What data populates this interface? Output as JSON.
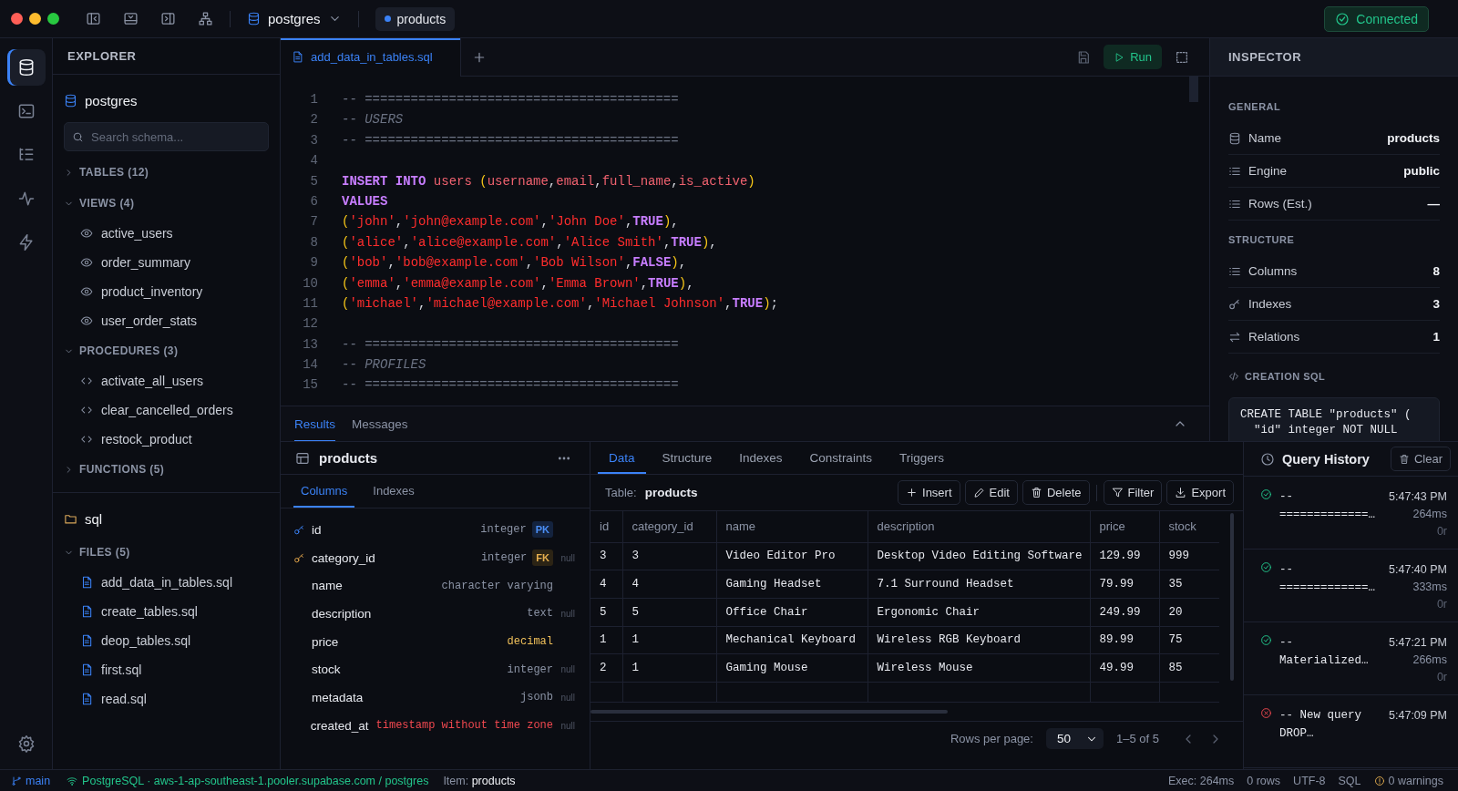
{
  "window_controls": [
    {
      "kind": "close"
    },
    {
      "kind": "minimize"
    },
    {
      "kind": "maximize"
    }
  ],
  "toolbar": {
    "connection_selector": {
      "label": "postgres"
    },
    "open_tab": {
      "label": "products"
    },
    "status": {
      "label": "Connected"
    }
  },
  "activity_bar": {
    "items": [
      {
        "selected": true
      },
      {
        "selected": false
      },
      {
        "selected": false
      },
      {
        "selected": false
      },
      {
        "selected": false
      }
    ]
  },
  "explorer": {
    "title": "EXPLORER",
    "connection": "postgres",
    "search": {
      "placeholder": "Search schema..."
    },
    "sections": [
      {
        "label": "TABLES (12)",
        "expanded": false
      },
      {
        "label": "VIEWS (4)",
        "kind": "view",
        "expanded": true,
        "items": [
          "active_users",
          "order_summary",
          "product_inventory",
          "user_order_stats"
        ]
      },
      {
        "label": "PROCEDURES (3)",
        "kind": "procedure",
        "expanded": true,
        "items": [
          "activate_all_users",
          "clear_cancelled_orders",
          "restock_product"
        ]
      },
      {
        "label": "FUNCTIONS (5)",
        "expanded": false
      }
    ],
    "folder": "sql",
    "file_sections": [
      {
        "label": "FILES (5)",
        "kind": "file",
        "expanded": true,
        "items": [
          "add_data_in_tables.sql",
          "create_tables.sql",
          "deop_tables.sql",
          "first.sql",
          "read.sql"
        ]
      }
    ]
  },
  "editor": {
    "tabs": [
      {
        "label": "add_data_in_tables.sql",
        "selected": true
      }
    ],
    "run_button": "Run",
    "lines": [
      {
        "number": "1",
        "tokens": [
          {
            "kind": "comment",
            "text": "-- ========================================="
          }
        ]
      },
      {
        "number": "2",
        "tokens": [
          {
            "kind": "comment",
            "text": "-- USERS"
          }
        ]
      },
      {
        "number": "3",
        "tokens": [
          {
            "kind": "comment",
            "text": "-- ========================================="
          }
        ]
      },
      {
        "number": "4"
      },
      {
        "number": "5",
        "tokens": [
          {
            "kind": "keyword",
            "text": "INSERT INTO"
          },
          {
            "kind": "ident",
            "text": " users "
          },
          {
            "kind": "paren",
            "text": "("
          },
          {
            "kind": "ident",
            "text": "username"
          },
          {
            "kind": "punct",
            "text": ","
          },
          {
            "kind": "ident",
            "text": "email"
          },
          {
            "kind": "punct",
            "text": ","
          },
          {
            "kind": "ident",
            "text": "full_name"
          },
          {
            "kind": "punct",
            "text": ","
          },
          {
            "kind": "ident",
            "text": "is_active"
          },
          {
            "kind": "paren",
            "text": ")"
          }
        ]
      },
      {
        "number": "6",
        "tokens": [
          {
            "kind": "keyword",
            "text": "VALUES"
          }
        ]
      },
      {
        "number": "7",
        "tokens": [
          {
            "kind": "paren",
            "text": "("
          },
          {
            "kind": "string",
            "text": "'john'"
          },
          {
            "kind": "punct",
            "text": ","
          },
          {
            "kind": "string",
            "text": "'john@example.com'"
          },
          {
            "kind": "punct",
            "text": ","
          },
          {
            "kind": "string",
            "text": "'John Doe'"
          },
          {
            "kind": "punct",
            "text": ","
          },
          {
            "kind": "keyword",
            "text": "TRUE"
          },
          {
            "kind": "paren",
            "text": ")"
          },
          {
            "kind": "punct",
            "text": ","
          }
        ]
      },
      {
        "number": "8",
        "tokens": [
          {
            "kind": "paren",
            "text": "("
          },
          {
            "kind": "string",
            "text": "'alice'"
          },
          {
            "kind": "punct",
            "text": ","
          },
          {
            "kind": "string",
            "text": "'alice@example.com'"
          },
          {
            "kind": "punct",
            "text": ","
          },
          {
            "kind": "string",
            "text": "'Alice Smith'"
          },
          {
            "kind": "punct",
            "text": ","
          },
          {
            "kind": "keyword",
            "text": "TRUE"
          },
          {
            "kind": "paren",
            "text": ")"
          },
          {
            "kind": "punct",
            "text": ","
          }
        ]
      },
      {
        "number": "9",
        "tokens": [
          {
            "kind": "paren",
            "text": "("
          },
          {
            "kind": "string",
            "text": "'bob'"
          },
          {
            "kind": "punct",
            "text": ","
          },
          {
            "kind": "string",
            "text": "'bob@example.com'"
          },
          {
            "kind": "punct",
            "text": ","
          },
          {
            "kind": "string",
            "text": "'Bob Wilson'"
          },
          {
            "kind": "punct",
            "text": ","
          },
          {
            "kind": "keyword",
            "text": "FALSE"
          },
          {
            "kind": "paren",
            "text": ")"
          },
          {
            "kind": "punct",
            "text": ","
          }
        ]
      },
      {
        "number": "10",
        "tokens": [
          {
            "kind": "paren",
            "text": "("
          },
          {
            "kind": "string",
            "text": "'emma'"
          },
          {
            "kind": "punct",
            "text": ","
          },
          {
            "kind": "string",
            "text": "'emma@example.com'"
          },
          {
            "kind": "punct",
            "text": ","
          },
          {
            "kind": "string",
            "text": "'Emma Brown'"
          },
          {
            "kind": "punct",
            "text": ","
          },
          {
            "kind": "keyword",
            "text": "TRUE"
          },
          {
            "kind": "paren",
            "text": ")"
          },
          {
            "kind": "punct",
            "text": ","
          }
        ]
      },
      {
        "number": "11",
        "tokens": [
          {
            "kind": "paren",
            "text": "("
          },
          {
            "kind": "string",
            "text": "'michael'"
          },
          {
            "kind": "punct",
            "text": ","
          },
          {
            "kind": "string",
            "text": "'michael@example.com'"
          },
          {
            "kind": "punct",
            "text": ","
          },
          {
            "kind": "string",
            "text": "'Michael Johnson'"
          },
          {
            "kind": "punct",
            "text": ","
          },
          {
            "kind": "keyword",
            "text": "TRUE"
          },
          {
            "kind": "paren",
            "text": ")"
          },
          {
            "kind": "punct",
            "text": ";"
          }
        ]
      },
      {
        "number": "12"
      },
      {
        "number": "13",
        "tokens": [
          {
            "kind": "comment",
            "text": "-- ========================================="
          }
        ]
      },
      {
        "number": "14",
        "tokens": [
          {
            "kind": "comment",
            "text": "-- PROFILES"
          }
        ]
      },
      {
        "number": "15",
        "tokens": [
          {
            "kind": "comment",
            "text": "-- ========================================="
          }
        ]
      }
    ]
  },
  "inspector": {
    "title": "INSPECTOR",
    "sections": [
      {
        "label": "GENERAL",
        "rows": [
          {
            "kind": "table",
            "label": "Name",
            "value": "products"
          },
          {
            "kind": "list",
            "label": "Engine",
            "value": "public"
          },
          {
            "kind": "list",
            "label": "Rows (Est.)",
            "value": "—"
          }
        ]
      },
      {
        "label": "STRUCTURE",
        "rows": [
          {
            "kind": "list",
            "label": "Columns",
            "value": "8"
          },
          {
            "kind": "key",
            "label": "Indexes",
            "value": "3"
          },
          {
            "kind": "relation",
            "label": "Relations",
            "value": "1"
          }
        ]
      }
    ],
    "creation_sql": {
      "label": "CREATION SQL",
      "lines": [
        "CREATE TABLE \"products\" (",
        "  \"id\" integer NOT NULL"
      ]
    }
  },
  "results_tabs": [
    {
      "label": "Results",
      "selected": true
    },
    {
      "label": "Messages",
      "selected": false
    }
  ],
  "schema_panel": {
    "title": "products",
    "tabs": [
      {
        "label": "Columns",
        "selected": true
      },
      {
        "label": "Indexes",
        "selected": false
      }
    ],
    "columns": [
      {
        "name": "id",
        "type": "integer",
        "color": "#8b93a5",
        "key": {
          "kind": "primary",
          "label": "PK"
        }
      },
      {
        "name": "category_id",
        "type": "integer",
        "color": "#8b93a5",
        "key": {
          "kind": "foreign",
          "label": "FK"
        },
        "note": "null"
      },
      {
        "name": "name",
        "type": "character varying",
        "color": "#8b93a5"
      },
      {
        "name": "description",
        "type": "text",
        "color": "#8b93a5",
        "note": "null"
      },
      {
        "name": "price",
        "type": "decimal",
        "color": "#f0c05a"
      },
      {
        "name": "stock",
        "type": "integer",
        "color": "#8b93a5",
        "note": "null"
      },
      {
        "name": "metadata",
        "type": "jsonb",
        "color": "#8b93a5",
        "note": "null"
      },
      {
        "name": "created_at",
        "type": "timestamp without time zone",
        "color": "#f0484f",
        "note": "null"
      }
    ]
  },
  "data_panel": {
    "tabs": [
      {
        "label": "Data",
        "selected": true
      },
      {
        "label": "Structure",
        "selected": false
      },
      {
        "label": "Indexes",
        "selected": false
      },
      {
        "label": "Constraints",
        "selected": false
      },
      {
        "label": "Triggers",
        "selected": false
      }
    ],
    "table_label": "Table:",
    "table_name": "products",
    "actions": [
      {
        "kind": "insert",
        "label": "Insert"
      },
      {
        "kind": "edit",
        "label": "Edit"
      },
      {
        "kind": "delete",
        "label": "Delete"
      },
      {
        "kind": "filter",
        "label": "Filter"
      },
      {
        "kind": "export",
        "label": "Export"
      }
    ],
    "table": {
      "columns": [
        "id",
        "category_id",
        "name",
        "description",
        "price",
        "stock"
      ],
      "rows": [
        [
          "3",
          "3",
          "Video Editor Pro",
          "Desktop Video Editing Software",
          "129.99",
          "999"
        ],
        [
          "4",
          "4",
          "Gaming Headset",
          "7.1 Surround Headset",
          "79.99",
          "35"
        ],
        [
          "5",
          "5",
          "Office Chair",
          "Ergonomic Chair",
          "249.99",
          "20"
        ],
        [
          "1",
          "1",
          "Mechanical Keyboard",
          "Wireless RGB Keyboard",
          "89.99",
          "75"
        ],
        [
          "2",
          "1",
          "Gaming Mouse",
          "Wireless Mouse",
          "49.99",
          "85"
        ]
      ]
    },
    "pager": {
      "label": "Rows per page:",
      "page_size": "50",
      "range": "1–5 of 5"
    }
  },
  "query_history": {
    "title": "Query History",
    "clear_button": "Clear",
    "entries": [
      {
        "ok": true,
        "query": [
          "--",
          "=============…"
        ],
        "time": "5:47:43 PM",
        "duration": "264ms",
        "rows": "0r"
      },
      {
        "ok": true,
        "query": [
          "--",
          "=============…"
        ],
        "time": "5:47:40 PM",
        "duration": "333ms",
        "rows": "0r"
      },
      {
        "ok": true,
        "query": [
          "--",
          "Materialized…"
        ],
        "time": "5:47:21 PM",
        "duration": "266ms",
        "rows": "0r"
      },
      {
        "ok": false,
        "query": [
          "-- New query",
          "DROP…"
        ],
        "time": "5:47:09 PM"
      }
    ]
  },
  "status_bar": {
    "branch": "main",
    "connection": "PostgreSQL · aws-1-ap-southeast-1.pooler.supabase.com / postgres",
    "item_label": "Item:",
    "item_value": "products",
    "exec": "Exec: 264ms",
    "rows": "0 rows",
    "encoding": "UTF-8",
    "language": "SQL",
    "warnings": "0 warnings"
  }
}
